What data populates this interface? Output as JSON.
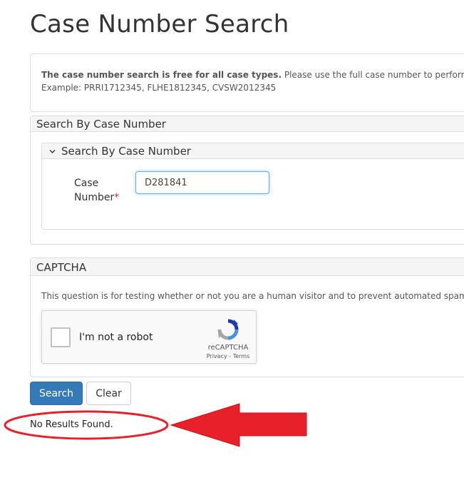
{
  "page": {
    "title": "Case Number Search"
  },
  "intro": {
    "bold_text": "The case number search is free for all case types.",
    "text": " Please use the full case number to perform",
    "example": "Example: PRRI1712345, FLHE1812345, CVSW2012345"
  },
  "search_panel": {
    "heading": "Search By Case Number",
    "sub_heading": "Search By Case Number",
    "field_label_line1": "Case",
    "field_label_line2": "Number",
    "required_mark": "*",
    "case_number_value": "D281841"
  },
  "captcha_panel": {
    "heading": "CAPTCHA",
    "description": "This question is for testing whether or not you are a human visitor and to prevent automated spam",
    "checkbox_label": "I'm not a robot",
    "brand": "reCAPTCHA",
    "terms": "Privacy - Terms"
  },
  "buttons": {
    "search": "Search",
    "clear": "Clear"
  },
  "result": {
    "message": "No Results Found."
  },
  "colors": {
    "primary": "#337ab7",
    "required": "#c9302c",
    "annotation": "#e8202a"
  },
  "icons": {
    "collapse": "chevron-down-icon",
    "recaptcha": "recaptcha-logo-icon",
    "annotation_arrow": "left-arrow-icon",
    "annotation_ellipse": "ellipse-highlight"
  }
}
